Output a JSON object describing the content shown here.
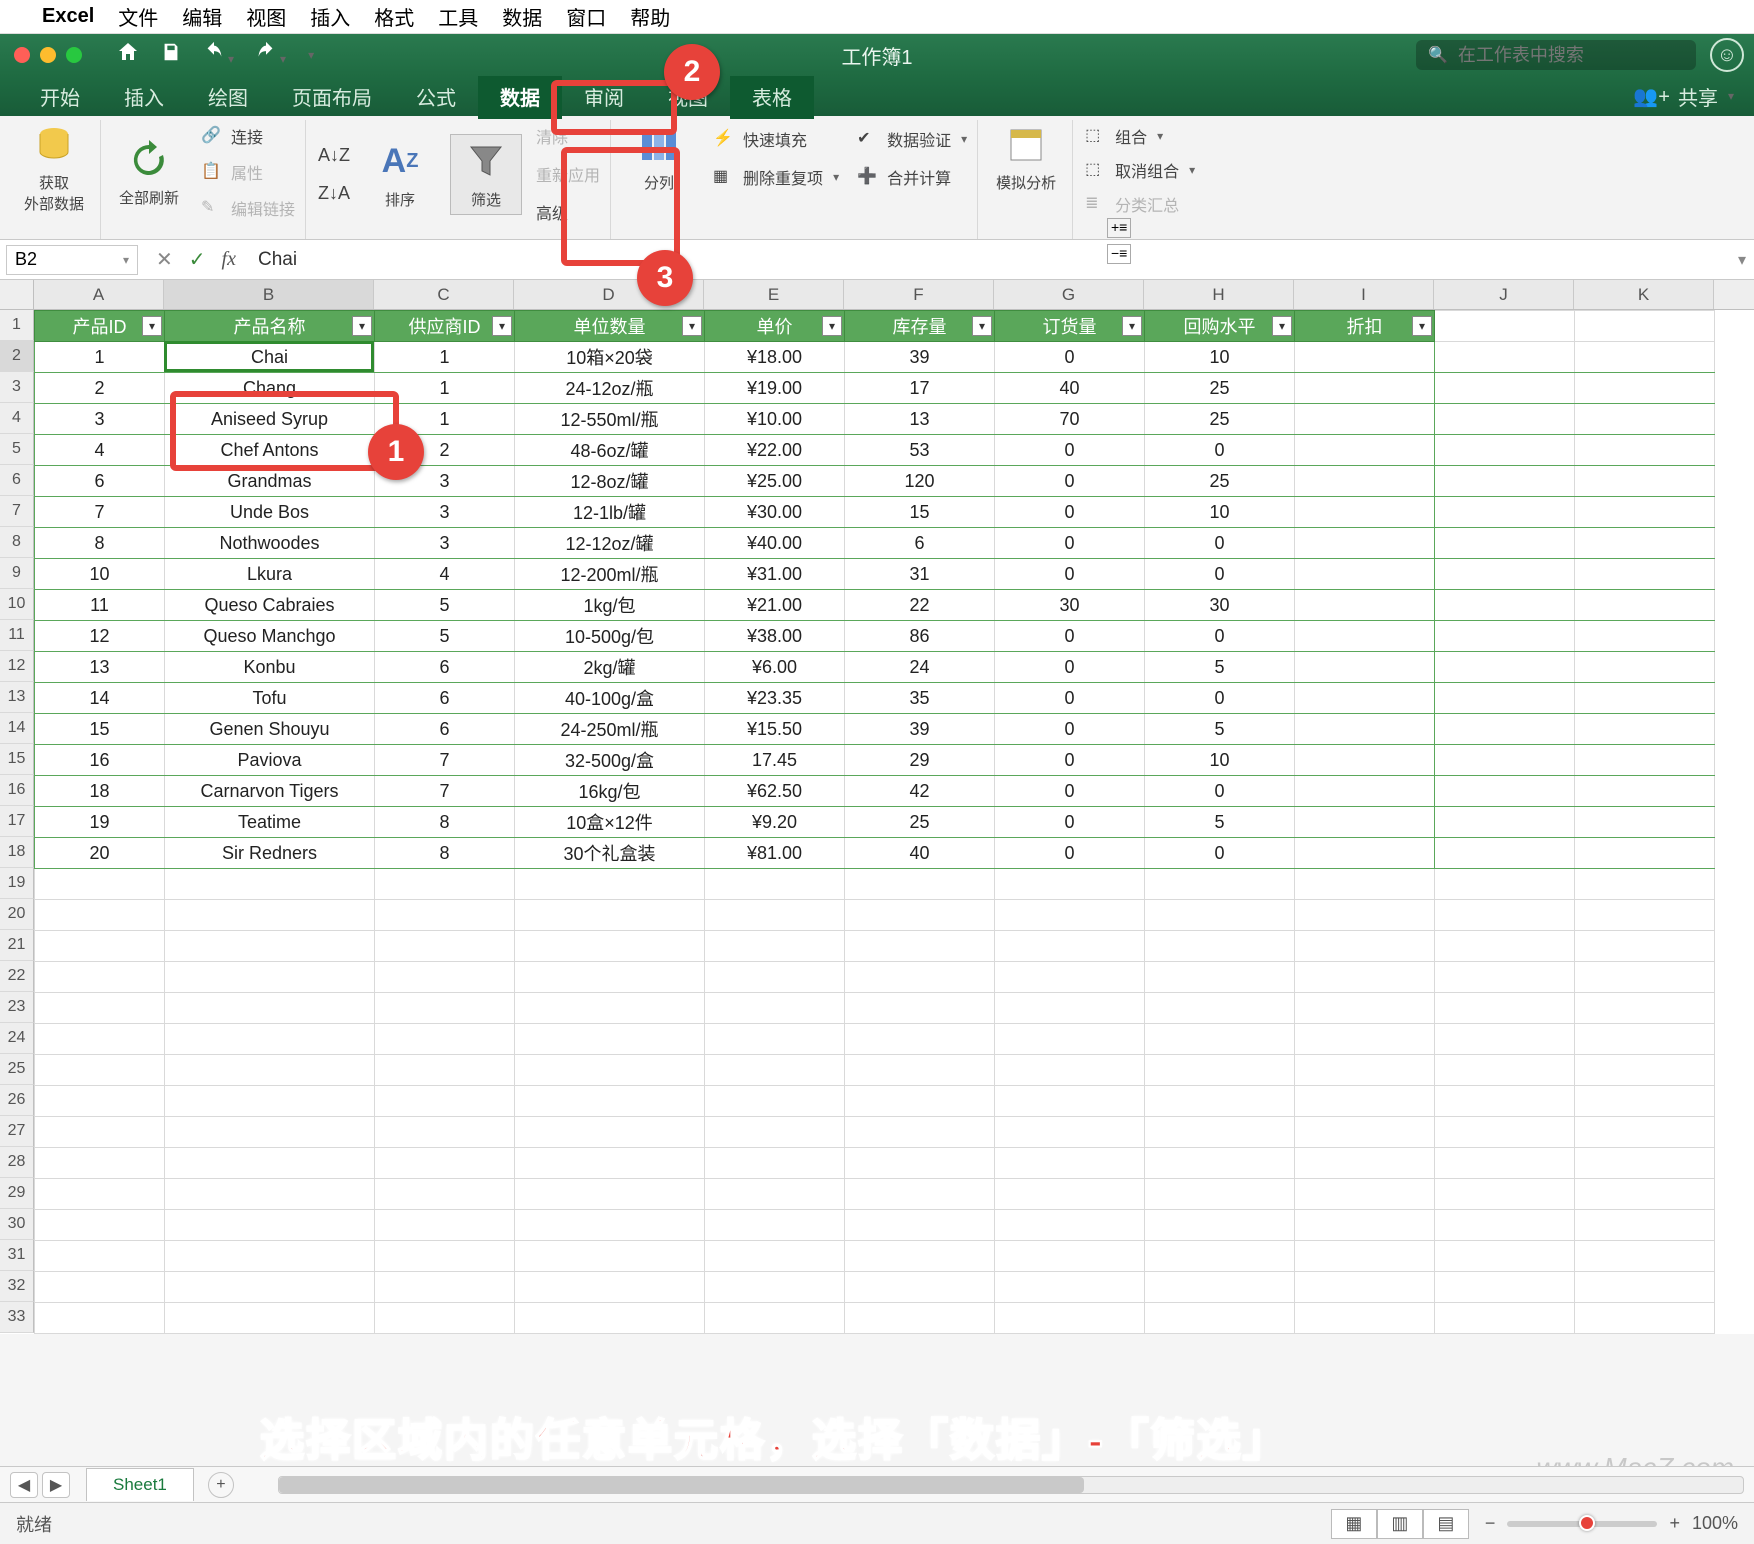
{
  "mac_menu": {
    "app": "Excel",
    "items": [
      "文件",
      "编辑",
      "视图",
      "插入",
      "格式",
      "工具",
      "数据",
      "窗口",
      "帮助"
    ]
  },
  "titlebar": {
    "doc": "工作簿1",
    "search_placeholder": "在工作表中搜索"
  },
  "ribbon_tabs": {
    "items": [
      "开始",
      "插入",
      "绘图",
      "页面布局",
      "公式",
      "数据",
      "审阅",
      "视图",
      "表格"
    ],
    "active": "数据",
    "share": "共享"
  },
  "ribbon": {
    "get_external": "获取\n外部数据",
    "refresh_all": "全部刷新",
    "connections": "连接",
    "properties": "属性",
    "edit_links": "编辑链接",
    "sort": "排序",
    "filter": "筛选",
    "clear": "清除",
    "reapply": "重新应用",
    "advanced": "高级",
    "text_to_cols": "分列",
    "flash_fill": "快速填充",
    "remove_dup": "删除重复项",
    "data_val": "数据验证",
    "consolidate": "合并计算",
    "what_if": "模拟分析",
    "group": "组合",
    "ungroup": "取消组合",
    "subtotal": "分类汇总"
  },
  "formula": {
    "cell_ref": "B2",
    "value": "Chai"
  },
  "columns": [
    "A",
    "B",
    "C",
    "D",
    "E",
    "F",
    "G",
    "H",
    "I",
    "J",
    "K"
  ],
  "headers": [
    "产品ID",
    "产品名称",
    "供应商ID",
    "单位数量",
    "单价",
    "库存量",
    "订货量",
    "回购水平",
    "折扣"
  ],
  "rows": [
    [
      "1",
      "Chai",
      "1",
      "10箱×20袋",
      "¥18.00",
      "39",
      "0",
      "10",
      ""
    ],
    [
      "2",
      "Chang",
      "1",
      "24-12oz/瓶",
      "¥19.00",
      "17",
      "40",
      "25",
      ""
    ],
    [
      "3",
      "Aniseed Syrup",
      "1",
      "12-550ml/瓶",
      "¥10.00",
      "13",
      "70",
      "25",
      ""
    ],
    [
      "4",
      "Chef Antons",
      "2",
      "48-6oz/罐",
      "¥22.00",
      "53",
      "0",
      "0",
      ""
    ],
    [
      "6",
      "Grandmas",
      "3",
      "12-8oz/罐",
      "¥25.00",
      "120",
      "0",
      "25",
      ""
    ],
    [
      "7",
      "Unde Bos",
      "3",
      "12-1lb/罐",
      "¥30.00",
      "15",
      "0",
      "10",
      ""
    ],
    [
      "8",
      "Nothwoodes",
      "3",
      "12-12oz/罐",
      "¥40.00",
      "6",
      "0",
      "0",
      ""
    ],
    [
      "10",
      "Lkura",
      "4",
      "12-200ml/瓶",
      "¥31.00",
      "31",
      "0",
      "0",
      ""
    ],
    [
      "11",
      "Queso Cabraies",
      "5",
      "1kg/包",
      "¥21.00",
      "22",
      "30",
      "30",
      ""
    ],
    [
      "12",
      "Queso Manchgo",
      "5",
      "10-500g/包",
      "¥38.00",
      "86",
      "0",
      "0",
      ""
    ],
    [
      "13",
      "Konbu",
      "6",
      "2kg/罐",
      "¥6.00",
      "24",
      "0",
      "5",
      ""
    ],
    [
      "14",
      "Tofu",
      "6",
      "40-100g/盒",
      "¥23.35",
      "35",
      "0",
      "0",
      ""
    ],
    [
      "15",
      "Genen Shouyu",
      "6",
      "24-250ml/瓶",
      "¥15.50",
      "39",
      "0",
      "5",
      ""
    ],
    [
      "16",
      "Paviova",
      "7",
      "32-500g/盒",
      "17.45",
      "29",
      "0",
      "10",
      ""
    ],
    [
      "18",
      "Carnarvon Tigers",
      "7",
      "16kg/包",
      "¥62.50",
      "42",
      "0",
      "0",
      ""
    ],
    [
      "19",
      "Teatime",
      "8",
      "10盒×12件",
      "¥9.20",
      "25",
      "0",
      "5",
      ""
    ],
    [
      "20",
      "Sir Redners",
      "8",
      "30个礼盒装",
      "¥81.00",
      "40",
      "0",
      "0",
      ""
    ]
  ],
  "row_numbers_total": 33,
  "sheet_tab": "Sheet1",
  "status": "就绪",
  "zoom": "100%",
  "caption": "选择区域内的任意单元格，选择「数据」-「筛选」",
  "watermark": "www.MacZ.com",
  "annotations": {
    "a1": "1",
    "a2": "2",
    "a3": "3"
  }
}
